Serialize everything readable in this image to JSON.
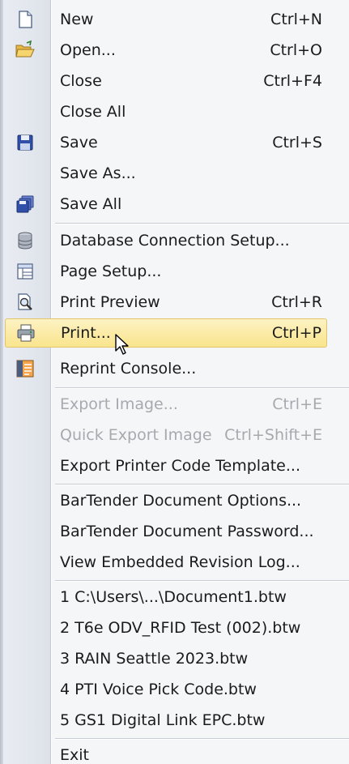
{
  "menu": {
    "items": [
      {
        "label": "New",
        "shortcut": "Ctrl+N",
        "icon": "new-document-icon"
      },
      {
        "label": "Open...",
        "shortcut": "Ctrl+O",
        "icon": "open-folder-icon"
      },
      {
        "label": "Close",
        "shortcut": "Ctrl+F4"
      },
      {
        "label": "Close All",
        "shortcut": ""
      },
      {
        "label": "Save",
        "shortcut": "Ctrl+S",
        "icon": "save-disk-icon"
      },
      {
        "label": "Save As...",
        "shortcut": ""
      },
      {
        "label": "Save All",
        "shortcut": "",
        "icon": "save-all-icon"
      },
      {
        "label": "Database Connection Setup...",
        "shortcut": "",
        "icon": "database-icon"
      },
      {
        "label": "Page Setup...",
        "shortcut": "",
        "icon": "page-setup-icon"
      },
      {
        "label": "Print Preview",
        "shortcut": "Ctrl+R",
        "icon": "print-preview-icon"
      },
      {
        "label": "Print...",
        "shortcut": "Ctrl+P",
        "icon": "printer-icon",
        "highlighted": true
      },
      {
        "label": "Reprint Console...",
        "shortcut": "",
        "icon": "reprint-console-icon"
      },
      {
        "label": "Export Image...",
        "shortcut": "Ctrl+E",
        "disabled": true
      },
      {
        "label": "Quick Export Image",
        "shortcut": "Ctrl+Shift+E",
        "disabled": true
      },
      {
        "label": "Export Printer Code Template...",
        "shortcut": ""
      },
      {
        "label": "BarTender Document Options...",
        "shortcut": ""
      },
      {
        "label": "BarTender Document Password...",
        "shortcut": ""
      },
      {
        "label": "View Embedded Revision Log...",
        "shortcut": ""
      },
      {
        "label": "1 C:\\Users\\...\\Document1.btw",
        "shortcut": ""
      },
      {
        "label": "2 T6e ODV_RFID Test (002).btw",
        "shortcut": ""
      },
      {
        "label": "3 RAIN Seattle 2023.btw",
        "shortcut": ""
      },
      {
        "label": "4 PTI Voice Pick Code.btw",
        "shortcut": ""
      },
      {
        "label": "5 GS1 Digital Link EPC.btw",
        "shortcut": ""
      },
      {
        "label": "Exit",
        "shortcut": ""
      }
    ]
  },
  "colors": {
    "highlight": "#f9e58c",
    "highlight_border": "#e3c46a",
    "disabled_text": "#a6a9ae",
    "gutter": "#e4e8ef"
  }
}
